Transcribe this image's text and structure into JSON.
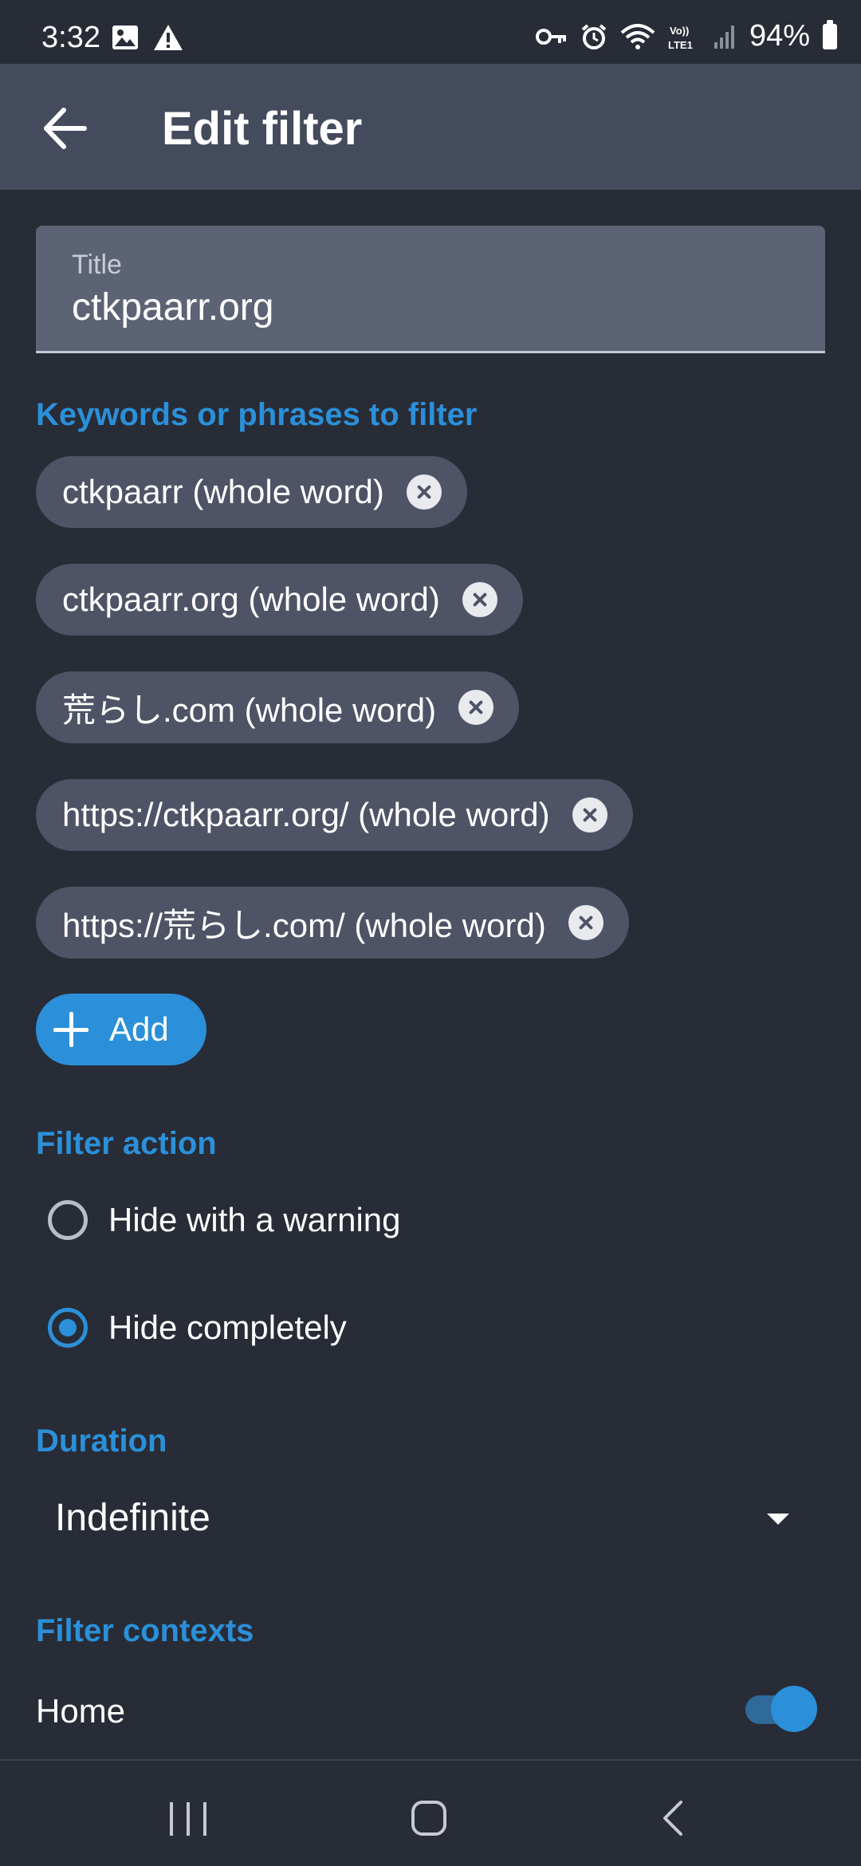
{
  "status_bar": {
    "time": "3:32",
    "battery": "94%",
    "icons": [
      "image-icon",
      "warning-icon",
      "vpn-key-icon",
      "alarm-icon",
      "wifi-icon",
      "volte-icon",
      "signal-icon",
      "battery-icon"
    ]
  },
  "app_bar": {
    "title": "Edit filter"
  },
  "title_field": {
    "label": "Title",
    "value": "ctkpaarr.org"
  },
  "keywords": {
    "section_label": "Keywords or phrases to filter",
    "items": [
      "ctkpaarr (whole word)",
      "ctkpaarr.org (whole word)",
      "荒らし.com (whole word)",
      "https://ctkpaarr.org/ (whole word)",
      "https://荒らし.com/ (whole word)"
    ],
    "add_label": "Add"
  },
  "filter_action": {
    "section_label": "Filter action",
    "options": [
      {
        "label": "Hide with a warning",
        "checked": false
      },
      {
        "label": "Hide completely",
        "checked": true
      }
    ]
  },
  "duration": {
    "section_label": "Duration",
    "selected": "Indefinite"
  },
  "filter_contexts": {
    "section_label": "Filter contexts",
    "items": [
      {
        "label": "Home",
        "enabled": true
      }
    ]
  },
  "colors": {
    "accent": "#2b90d9",
    "background": "#282c37",
    "app_bar": "#444b5d",
    "chip": "#4e5465"
  }
}
